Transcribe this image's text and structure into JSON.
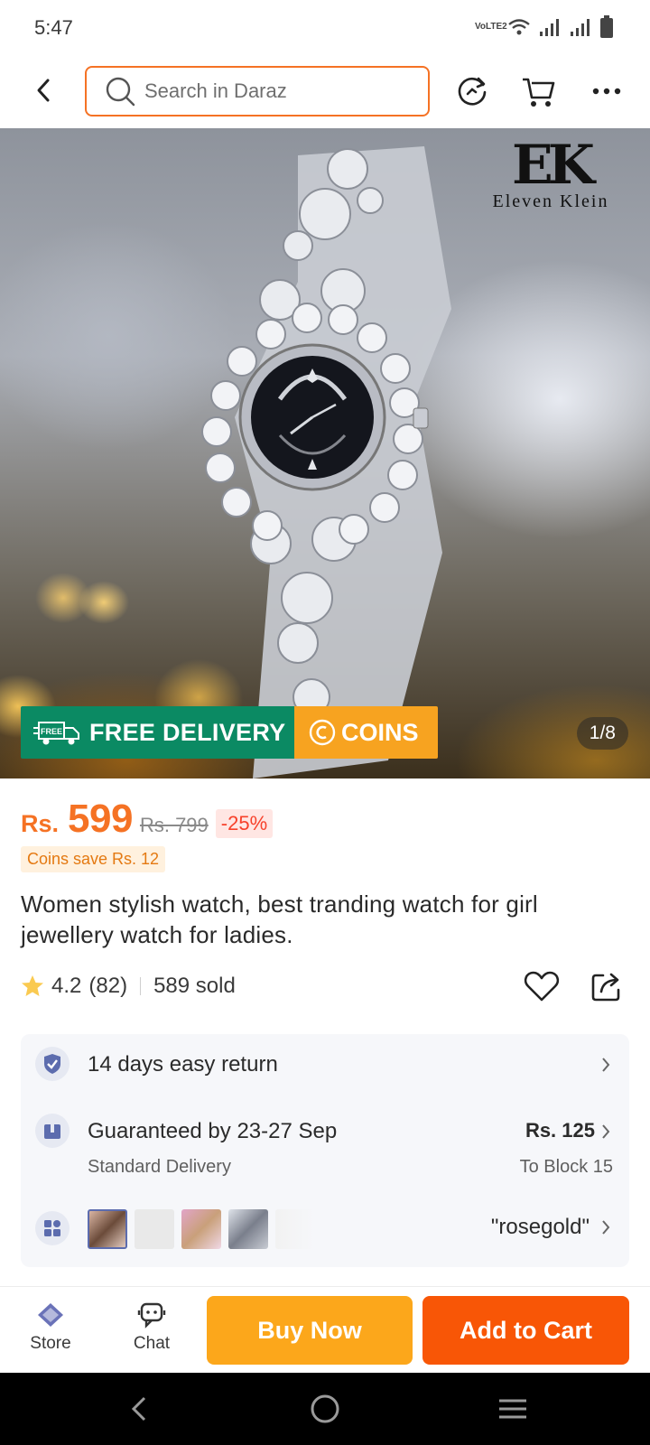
{
  "status_bar": {
    "time": "5:47",
    "network_label": "VoLTE2"
  },
  "top_bar": {
    "search_placeholder": "Search in Daraz",
    "icons": [
      "back-icon",
      "search-icon",
      "reload-icon",
      "cart-icon",
      "more-icon"
    ]
  },
  "product_image": {
    "brand_mark": "EK",
    "brand_name": "Eleven Klein",
    "promo_free_badge": "FREE",
    "promo_free": "FREE DELIVERY",
    "promo_coins": "COINS",
    "counter": "1/8"
  },
  "price": {
    "currency": "Rs.",
    "value": "599",
    "original": "Rs. 799",
    "discount": "-25%",
    "coins_save": "Coins save Rs. 12"
  },
  "product": {
    "title": "Women stylish watch, best tranding watch for girl jewellery watch for ladies.",
    "rating": "4.2",
    "rating_count": "(82)",
    "sold": "589 sold"
  },
  "info": {
    "return_text": "14 days easy return",
    "delivery_main": "Guaranteed by 23-27 Sep",
    "delivery_type": "Standard Delivery",
    "delivery_fee": "Rs. 125",
    "delivery_location": "To Block 15",
    "variant_selected": "\"rosegold\""
  },
  "actions": {
    "store": "Store",
    "chat": "Chat",
    "buy_now": "Buy Now",
    "add_to_cart": "Add to Cart"
  },
  "colors": {
    "accent": "#f57224",
    "buy_now": "#fca71b",
    "add_to_cart": "#f85606",
    "free_delivery": "#0b8a63",
    "coins": "#f7a320"
  }
}
